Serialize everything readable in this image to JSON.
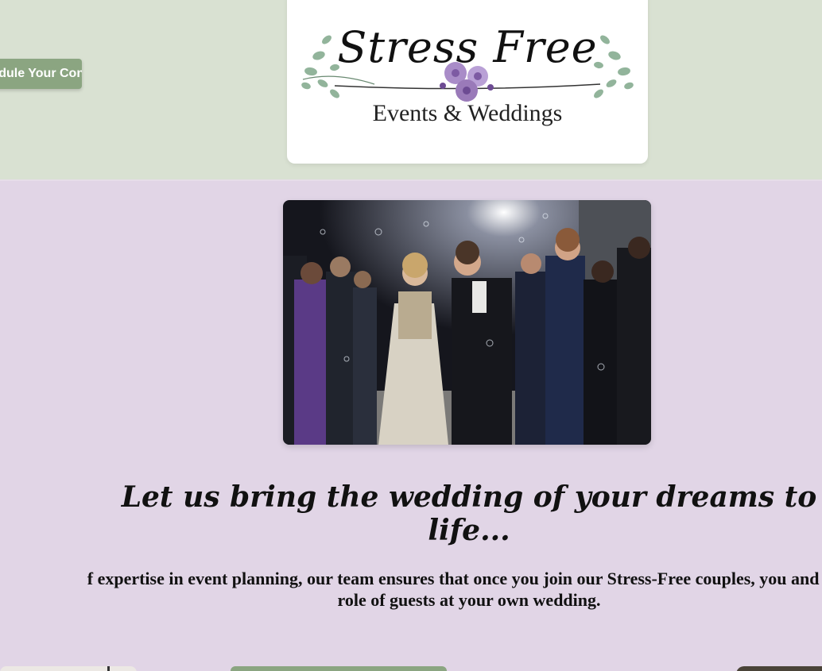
{
  "header": {
    "cta_label": "Schedule Your Consultation Today",
    "logo": {
      "script_text": "Stress Free",
      "subtitle": "Events & Weddings"
    }
  },
  "main": {
    "photo_description_icon": "wedding-photo",
    "tagline": "Let us bring the wedding of your dreams to life...",
    "paragraph_line1": "f expertise in event planning, our team ensures that once you join our Stress-Free couples, you and you",
    "paragraph_line2": "role of guests at your own wedding."
  },
  "colors": {
    "header_bg": "#d9e1d2",
    "body_bg": "#e1d5e6",
    "accent_green": "#8ba581"
  }
}
